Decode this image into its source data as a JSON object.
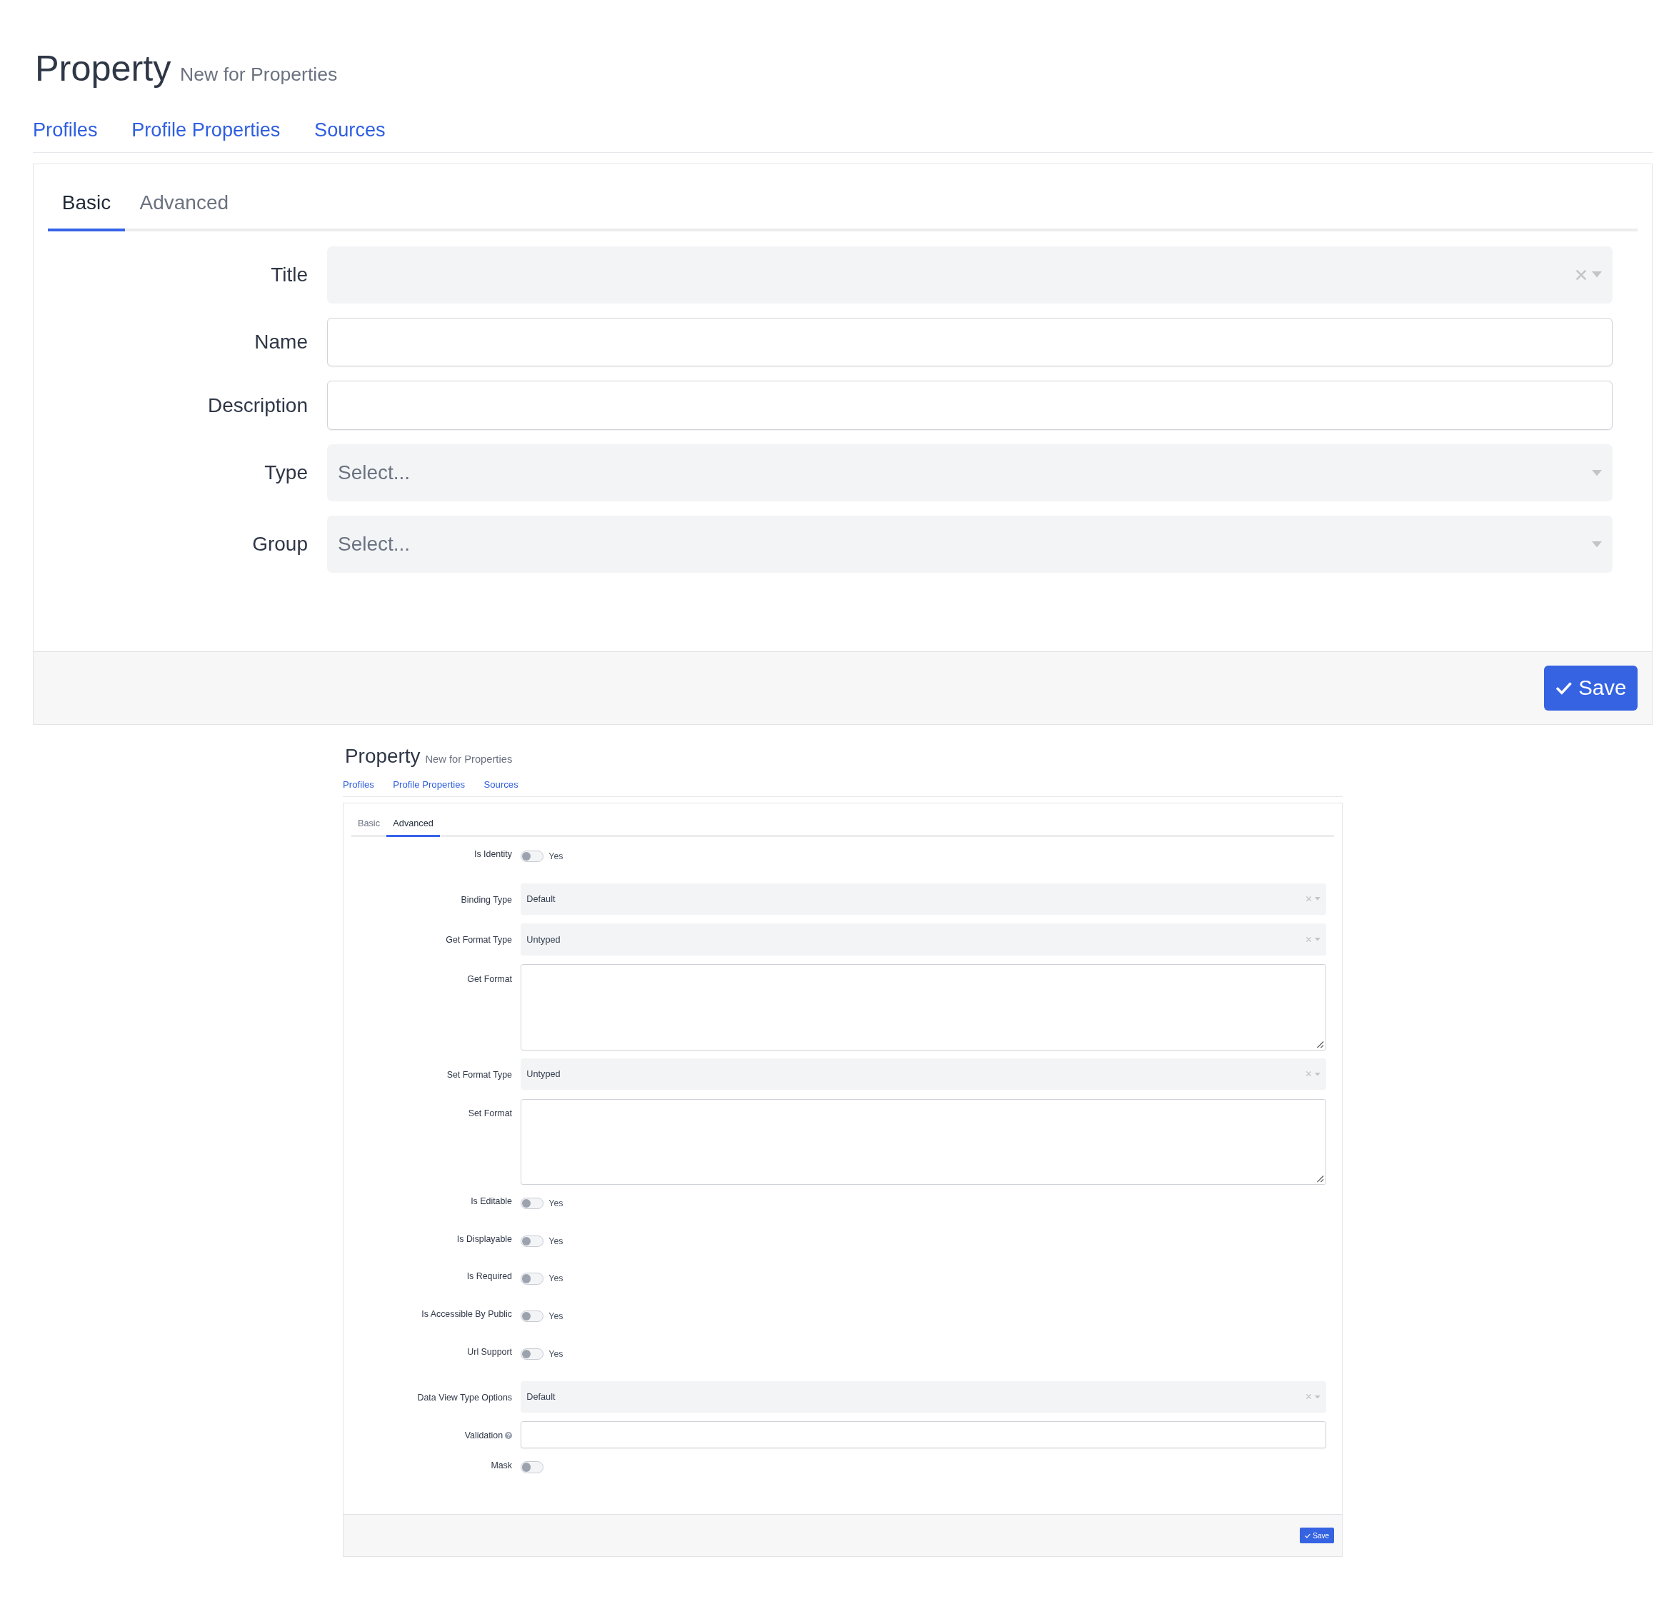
{
  "panels": [
    {
      "title": "Property",
      "subtitle": "New for Properties",
      "nav": [
        {
          "label": "Profiles"
        },
        {
          "label": "Profile Properties"
        },
        {
          "label": "Sources"
        }
      ],
      "tabs": [
        {
          "label": "Basic",
          "selected": true
        },
        {
          "label": "Advanced",
          "selected": false
        }
      ],
      "fields": [
        {
          "kind": "select",
          "label": "Title",
          "clearable": true
        },
        {
          "kind": "input",
          "label": "Name"
        },
        {
          "kind": "input",
          "label": "Description"
        },
        {
          "kind": "select",
          "label": "Type",
          "placeholder": "Select...",
          "clearable": false
        },
        {
          "kind": "select",
          "label": "Group",
          "placeholder": "Select...",
          "clearable": false
        }
      ],
      "save": "Save"
    },
    {
      "title": "Property",
      "subtitle": "New for Properties",
      "nav": [
        {
          "label": "Profiles"
        },
        {
          "label": "Profile Properties"
        },
        {
          "label": "Sources"
        }
      ],
      "tabs": [
        {
          "label": "Basic",
          "selected": false
        },
        {
          "label": "Advanced",
          "selected": true
        }
      ],
      "fields": [
        {
          "kind": "toggle",
          "label": "Is Identity",
          "option": "Yes",
          "checked": false
        },
        {
          "kind": "select",
          "label": "Binding Type",
          "value": "Default",
          "clearable": true
        },
        {
          "kind": "select",
          "label": "Get Format Type",
          "value": "Untyped",
          "clearable": true
        },
        {
          "kind": "textarea",
          "label": "Get Format"
        },
        {
          "kind": "select",
          "label": "Set Format Type",
          "value": "Untyped",
          "clearable": true
        },
        {
          "kind": "textarea",
          "label": "Set Format"
        },
        {
          "kind": "toggle",
          "label": "Is Editable",
          "option": "Yes",
          "checked": false
        },
        {
          "kind": "toggle",
          "label": "Is Displayable",
          "option": "Yes",
          "checked": false
        },
        {
          "kind": "toggle",
          "label": "Is Required",
          "option": "Yes",
          "checked": false
        },
        {
          "kind": "toggle",
          "label": "Is Accessible By Public",
          "option": "Yes",
          "checked": false
        },
        {
          "kind": "toggle",
          "label": "Url Support",
          "option": "Yes",
          "checked": false
        },
        {
          "kind": "select",
          "label": "Data View Type Options",
          "value": "Default",
          "clearable": true
        },
        {
          "kind": "input",
          "label": "Validation",
          "help": "?"
        },
        {
          "kind": "toggle",
          "label": "Mask",
          "checked": false
        }
      ],
      "save": "Save"
    }
  ]
}
